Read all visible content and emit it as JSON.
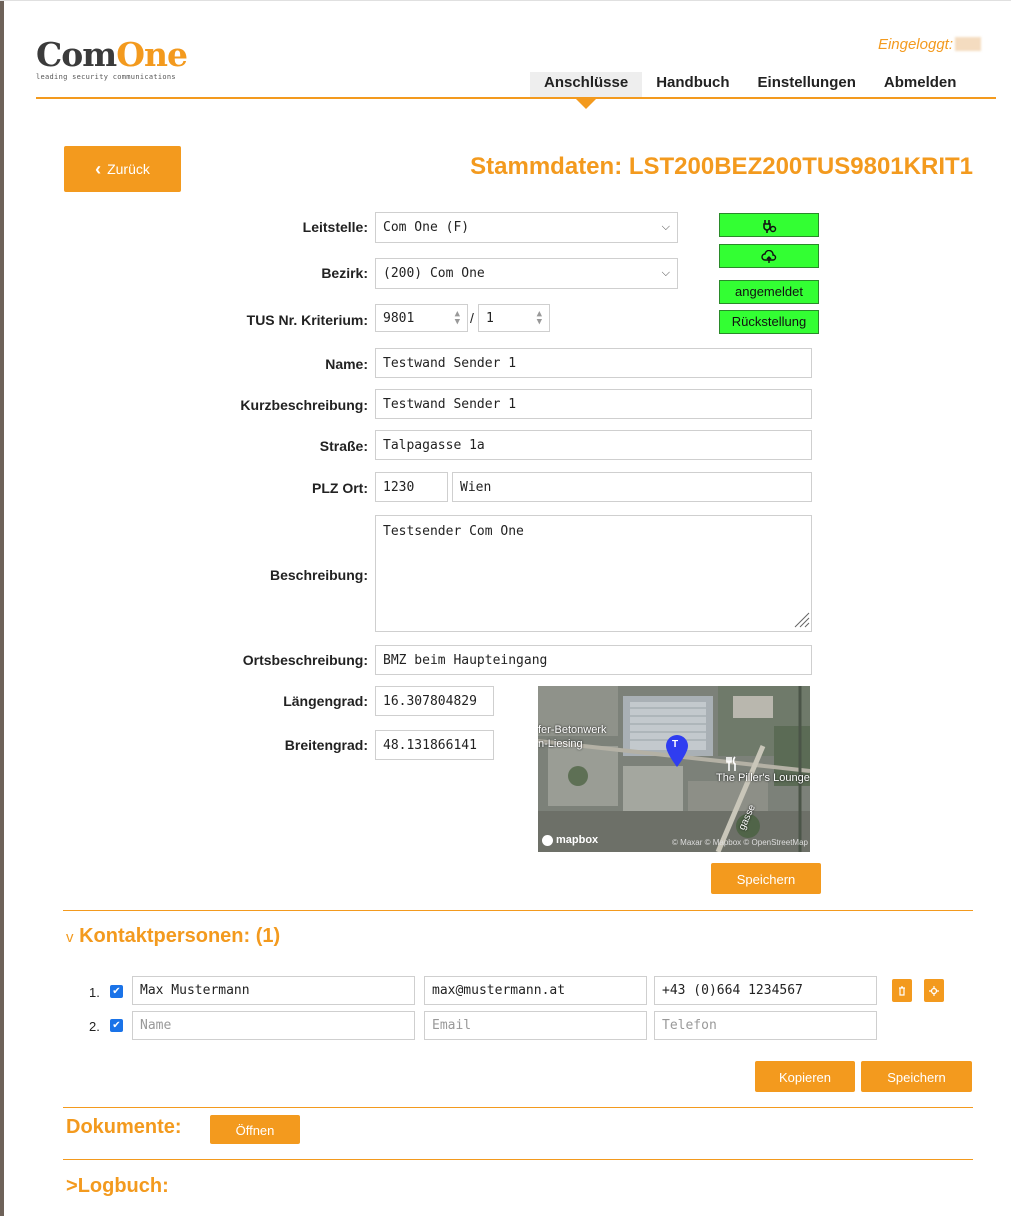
{
  "header": {
    "logo_main_a": "Com",
    "logo_main_b": "One",
    "logo_sub": "leading security communications",
    "logged_in": "Eingeloggt:",
    "nav": [
      "Anschlüsse",
      "Handbuch",
      "Einstellungen",
      "Abmelden"
    ],
    "active_nav": "Anschlüsse"
  },
  "back_label": "Zurück",
  "title": "Stammdaten: LST200BEZ200TUS9801KRIT1",
  "form": {
    "leitstelle_label": "Leitstelle:",
    "leitstelle_value": "Com One (F)",
    "bezirk_label": "Bezirk:",
    "bezirk_value": "(200) Com One",
    "tus_label": "TUS Nr. Kriterium:",
    "tus_value": "9801",
    "tus_sep": "/",
    "kriterium_value": "1",
    "name_label": "Name:",
    "name_value": "Testwand Sender 1",
    "kurz_label": "Kurzbeschreibung:",
    "kurz_value": "Testwand Sender 1",
    "strasse_label": "Straße:",
    "strasse_value": "Talpagasse 1a",
    "plzort_label": "PLZ Ort:",
    "plz_value": "1230",
    "ort_value": "Wien",
    "beschreibung_label": "Beschreibung:",
    "beschreibung_value": "Testsender Com One",
    "ortsbeschreibung_label": "Ortsbeschreibung:",
    "ortsbeschreibung_value": "BMZ beim Haupteingang",
    "laengengrad_label": "Längengrad:",
    "laengengrad_value": "16.307804829",
    "breitengrad_label": "Breitengrad:",
    "breitengrad_value": "48.131866141"
  },
  "status": {
    "plug_icon": "plug-icon",
    "cloud_icon": "cloud-upload-icon",
    "registered": "angemeldet",
    "reset": "Rückstellung",
    "color": "#33ff33"
  },
  "map": {
    "label_1": "fer-Betonwerk",
    "label_2": "n-Liesing",
    "poi": "The Piller's Lounge",
    "street": "gasse",
    "marker_letter": "T",
    "brand": "mapbox",
    "attribution": "© Maxar © Mapbox © OpenStreetMap"
  },
  "save_label": "Speichern",
  "contacts": {
    "title": "Kontaktpersonen: (1)",
    "toggle": "v",
    "rows": [
      {
        "num": "1.",
        "name": "Max Mustermann",
        "email": "max@mustermann.at",
        "phone": "+43 (0)664 1234567"
      },
      {
        "num": "2.",
        "name": "",
        "email": "",
        "phone": ""
      }
    ],
    "placeholders": {
      "name": "Name",
      "email": "Email",
      "phone": "Telefon"
    },
    "copy_label": "Kopieren",
    "save_label": "Speichern"
  },
  "documents": {
    "title": "Dokumente:",
    "open_label": "Öffnen"
  },
  "logbook": {
    "title": "Logbuch:",
    "toggle": ">"
  },
  "colors": {
    "accent": "#f39a1e",
    "status_green": "#33ff33"
  }
}
